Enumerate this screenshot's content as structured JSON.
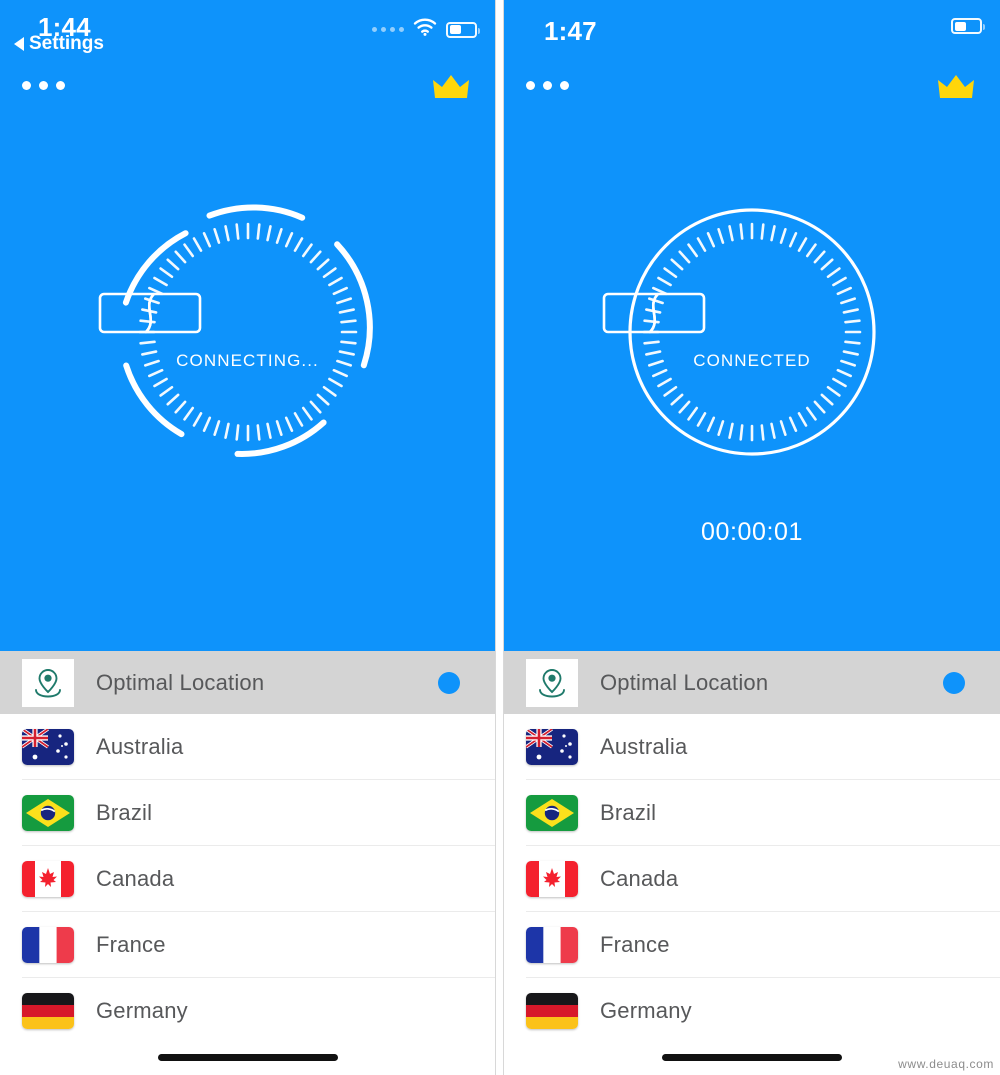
{
  "meta": {
    "accent_blue": "#0e93fb",
    "selected_row_bg": "#d4d4d4",
    "crown_color": "#ffd60a",
    "pin_color": "#1f7a6b",
    "watermark": "www.deuaq.com"
  },
  "panels": [
    {
      "id": "connecting",
      "status_bar": {
        "time": "1:44",
        "back_label": "Settings",
        "back_icon": "back-caret-icon",
        "signal_icon": "signal-dots-icon",
        "wifi_icon": "wifi-icon",
        "battery_icon": "battery-icon",
        "battery_percent": 45,
        "show_wifi": true,
        "show_signal": true,
        "show_back": true
      },
      "nav": {
        "menu_icon": "more-menu-icon",
        "premium_icon": "crown-icon"
      },
      "dial": {
        "state": "connecting",
        "status_text": "CONNECTING...",
        "link_icon": "vpn-link-icon",
        "ring_style": "segmented",
        "tick_count": 60
      },
      "timer": {
        "visible": false,
        "value": ""
      },
      "list": {
        "items": [
          {
            "label": "Optimal Location",
            "icon": "optimal-location-pin-icon",
            "selected": true,
            "type": "optimal"
          },
          {
            "label": "Australia",
            "icon": "flag-australia",
            "selected": false,
            "type": "country"
          },
          {
            "label": "Brazil",
            "icon": "flag-brazil",
            "selected": false,
            "type": "country"
          },
          {
            "label": "Canada",
            "icon": "flag-canada",
            "selected": false,
            "type": "country"
          },
          {
            "label": "France",
            "icon": "flag-france",
            "selected": false,
            "type": "country"
          },
          {
            "label": "Germany",
            "icon": "flag-germany",
            "selected": false,
            "type": "country"
          }
        ]
      }
    },
    {
      "id": "connected",
      "status_bar": {
        "time": "1:47",
        "back_label": "",
        "back_icon": "",
        "signal_icon": "",
        "wifi_icon": "",
        "battery_icon": "battery-icon",
        "battery_percent": 45,
        "show_wifi": false,
        "show_signal": false,
        "show_back": false
      },
      "nav": {
        "menu_icon": "more-menu-icon",
        "premium_icon": "crown-icon"
      },
      "dial": {
        "state": "connected",
        "status_text": "CONNECTED",
        "link_icon": "vpn-link-icon",
        "ring_style": "solid",
        "tick_count": 60
      },
      "timer": {
        "visible": true,
        "value": "00:00:01"
      },
      "list": {
        "items": [
          {
            "label": "Optimal Location",
            "icon": "optimal-location-pin-icon",
            "selected": true,
            "type": "optimal"
          },
          {
            "label": "Australia",
            "icon": "flag-australia",
            "selected": false,
            "type": "country"
          },
          {
            "label": "Brazil",
            "icon": "flag-brazil",
            "selected": false,
            "type": "country"
          },
          {
            "label": "Canada",
            "icon": "flag-canada",
            "selected": false,
            "type": "country"
          },
          {
            "label": "France",
            "icon": "flag-france",
            "selected": false,
            "type": "country"
          },
          {
            "label": "Germany",
            "icon": "flag-germany",
            "selected": false,
            "type": "country"
          }
        ]
      }
    }
  ]
}
